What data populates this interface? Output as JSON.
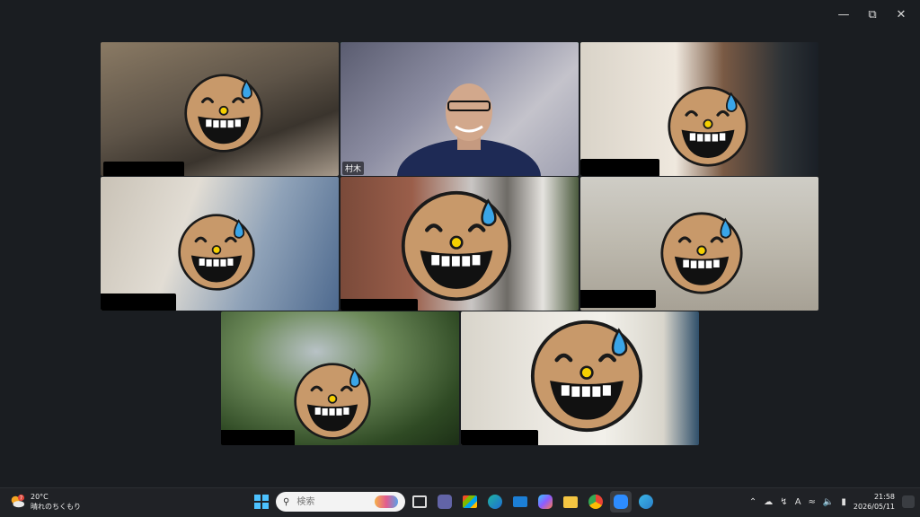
{
  "window": {
    "minimize_icon": "minimize-icon",
    "restore_icon": "restore-icon",
    "close_icon": "close-icon"
  },
  "participants": [
    {
      "id": "p1",
      "name": "",
      "active": false
    },
    {
      "id": "p2",
      "name": "村木",
      "active": true
    },
    {
      "id": "p3",
      "name": "",
      "active": false
    },
    {
      "id": "p4",
      "name": "",
      "active": false
    },
    {
      "id": "p5",
      "name": "",
      "active": false
    },
    {
      "id": "p6",
      "name": "",
      "active": false
    },
    {
      "id": "p7",
      "name": "",
      "active": false
    },
    {
      "id": "p8",
      "name": "",
      "active": false
    }
  ],
  "colors": {
    "active_border": "#25d366",
    "background": "#1a1d21",
    "taskbar": "#202226",
    "face": "#c8996a",
    "sweat": "#3aa5e8",
    "nose": "#f5d000"
  },
  "taskbar": {
    "weather": {
      "badge": "7",
      "temp": "20°C",
      "desc": "晴れのちくもり"
    },
    "search_placeholder": "検索",
    "clock": {
      "time": "21:58",
      "date": "2026/05/11"
    },
    "ime_label": "A",
    "icons": [
      "windows-start-icon",
      "search-icon",
      "task-view-icon",
      "teams-icon",
      "store-icon",
      "edge-icon",
      "mail-icon",
      "copilot-icon",
      "file-explorer-icon",
      "chrome-icon",
      "zoom-icon",
      "browser-icon"
    ]
  }
}
